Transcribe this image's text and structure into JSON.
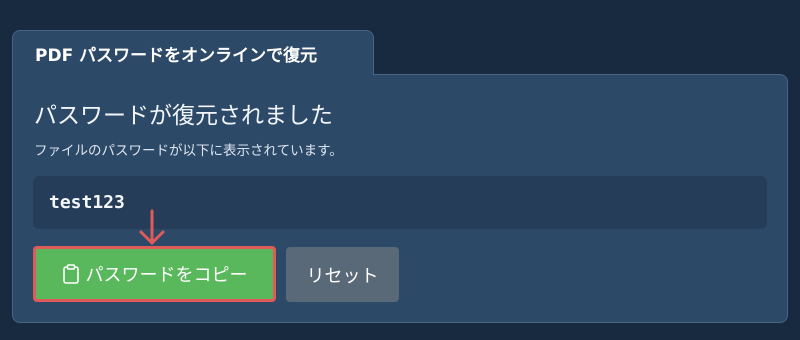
{
  "tab": {
    "title": "PDF パスワードをオンラインで復元"
  },
  "result": {
    "heading": "パスワードが復元されました",
    "subtitle": "ファイルのパスワードが以下に表示されています。",
    "password": "test123"
  },
  "actions": {
    "copy_label": "パスワードをコピー",
    "reset_label": "リセット"
  },
  "icons": {
    "copy": "clipboard-icon",
    "annotation": "arrow-down-icon"
  },
  "colors": {
    "background": "#182a3f",
    "panel": "#2d4968",
    "copy_button": "#5ab85c",
    "highlight": "#e05a5a",
    "reset_button": "#5a6978"
  }
}
